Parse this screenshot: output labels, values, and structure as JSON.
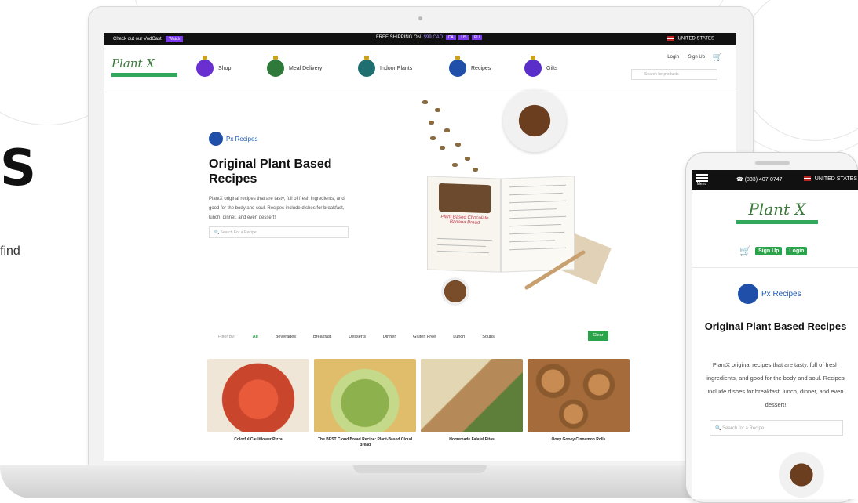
{
  "left_text": {
    "big": "S",
    "small": "find"
  },
  "topbar": {
    "promo_text": "Check out our VodCast",
    "promo_button": "Watch",
    "shipping_text": "FREE SHIPPING ON",
    "shipping_link": "$99 CAD",
    "selector": [
      "CA",
      "US",
      "EU"
    ],
    "country": "UNITED STATES"
  },
  "header": {
    "logo": "Plant X",
    "nav": [
      {
        "label": "Shop",
        "color": "#6a2fd1"
      },
      {
        "label": "Meal Delivery",
        "color": "#2f7a3a"
      },
      {
        "label": "Indoor Plants",
        "color": "#1f6f70"
      },
      {
        "label": "Recipes",
        "color": "#1f4fa8"
      },
      {
        "label": "Gifts",
        "color": "#5a2fc9"
      }
    ],
    "login": "Login",
    "signup": "Sign Up",
    "search_placeholder": "Search for products"
  },
  "hero": {
    "badge": "Px Recipes",
    "title": "Original Plant Based Recipes",
    "description": "PlantX original recipes that are tasty, full of fresh ingredients, and good for the body and soul. Recipes include dishes for breakfast, lunch, dinner, and even dessert!",
    "search_placeholder": "Search For a Recipe",
    "book_title": "Plant Based Chocolate Banana Bread"
  },
  "filter": {
    "label": "Filter By:",
    "items": [
      "All",
      "Beverages",
      "Breakfast",
      "Desserts",
      "Dinner",
      "Gluten Free",
      "Lunch",
      "Soups"
    ],
    "active": "All",
    "clear": "Clear"
  },
  "cards": [
    {
      "title": "Colorful Cauliflower Pizza",
      "color": "#c9452c"
    },
    {
      "title": "The BEST Cloud Bread Recipe: Plant-Based Cloud Bread",
      "color": "#8db24d"
    },
    {
      "title": "Homemade Falafel Pitas",
      "color": "#d8c79c"
    },
    {
      "title": "Ooey Gooey Cinnamon Rolls",
      "color": "#a56b3b"
    }
  ],
  "phone": {
    "menu": "Menu",
    "phone_number": "(833) 407-0747",
    "country": "UNITED STATES",
    "logo": "Plant X",
    "signup": "Sign Up",
    "login": "Login",
    "badge": "Px Recipes",
    "title": "Original Plant Based Recipes",
    "description": "PlantX original recipes that are tasty, full of fresh ingredients, and good for the body and soul. Recipes include dishes for breakfast, lunch, dinner, and even dessert!",
    "search_placeholder": "Search for a Recipe"
  }
}
